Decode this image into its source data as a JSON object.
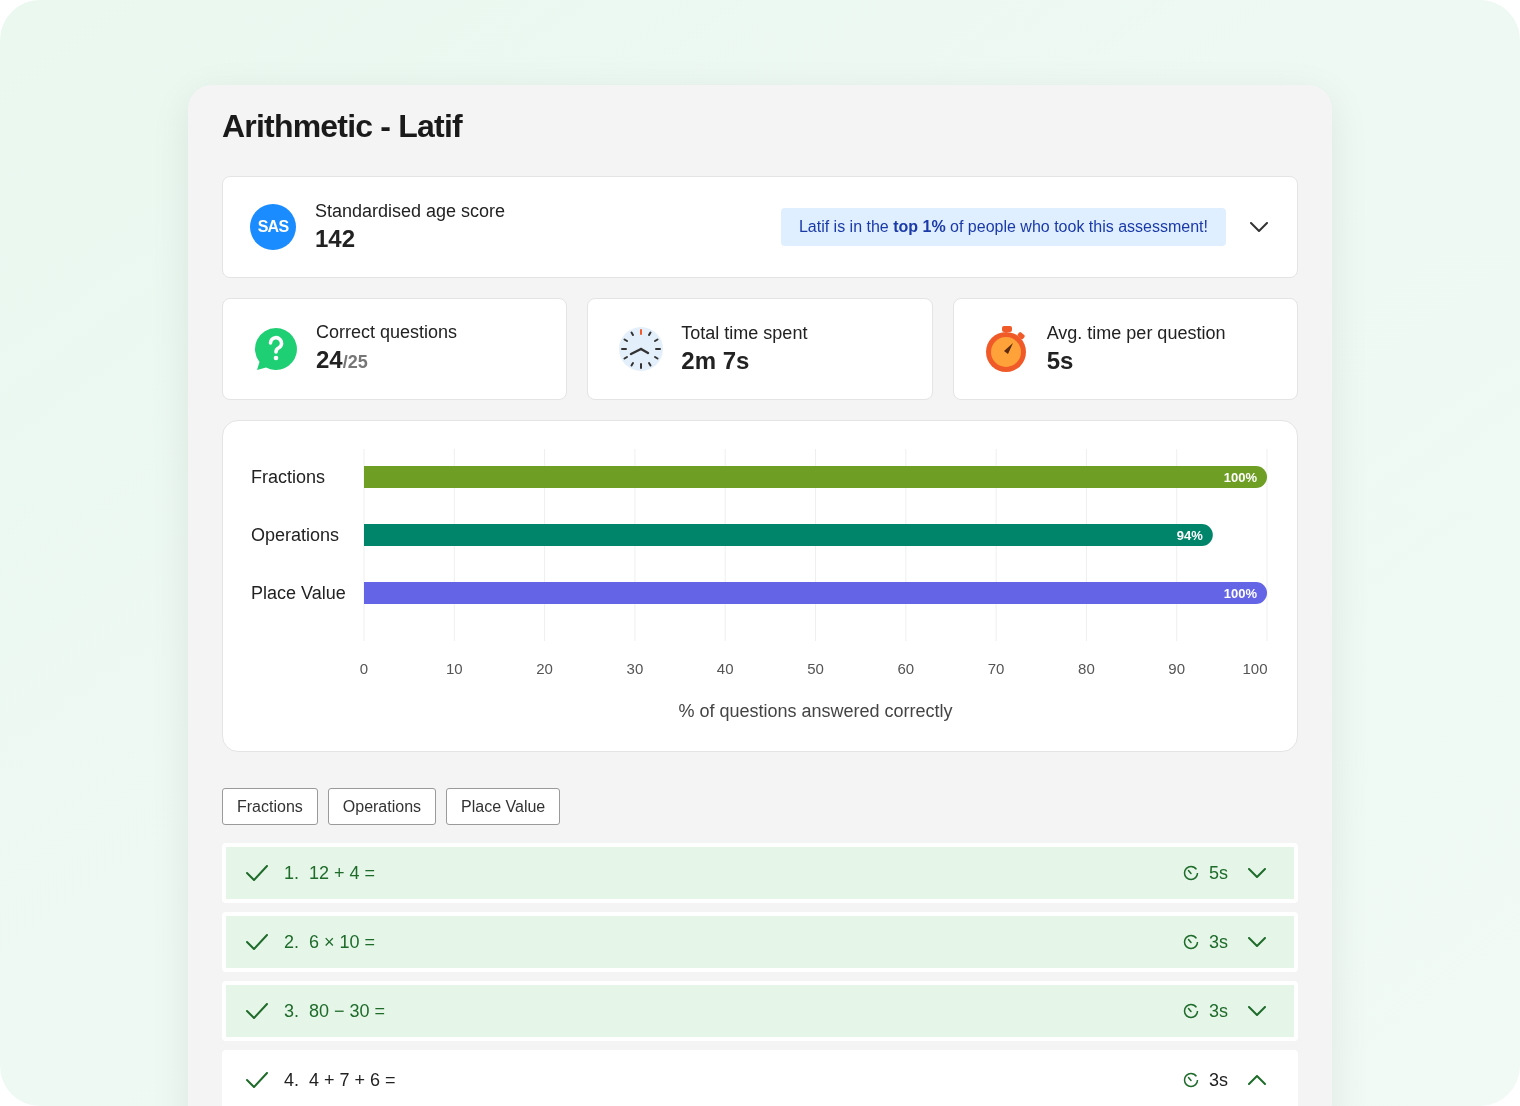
{
  "title": "Arithmetic - Latif",
  "sas": {
    "badge": "SAS",
    "label": "Standardised age score",
    "value": "142",
    "message": "Latif is in the **top 1%** of people who took this assessment!",
    "expanded": false
  },
  "stats": [
    {
      "kind": "correct",
      "label": "Correct questions",
      "value": "24",
      "suffix": "/25"
    },
    {
      "kind": "clock",
      "label": "Total time spent",
      "value": "2m 7s"
    },
    {
      "kind": "stopwatch",
      "label": "Avg. time per question",
      "value": "5s"
    }
  ],
  "chart_data": {
    "type": "bar",
    "orientation": "horizontal",
    "xlabel": "% of questions answered correctly",
    "categories": [
      "Fractions",
      "Operations",
      "Place Value"
    ],
    "series": [
      {
        "values": [
          100,
          94,
          100
        ]
      }
    ],
    "value_labels": [
      "100%",
      "94%",
      "100%"
    ],
    "grid": true,
    "colors": [
      "#6f9e25",
      "#00856a",
      "#6464e6"
    ],
    "xlim": [
      0,
      100
    ],
    "xticks": [
      0,
      10,
      20,
      30,
      40,
      50,
      60,
      70,
      80,
      90,
      100
    ]
  },
  "filters": [
    {
      "label": "Fractions",
      "selected": false
    },
    {
      "label": "Operations",
      "selected": false
    },
    {
      "label": "Place Value",
      "selected": false
    }
  ],
  "questions": [
    {
      "number": "1.",
      "text": "12 + 4 =",
      "time": "5s",
      "correct": true,
      "expanded": false
    },
    {
      "number": "2.",
      "text": "6 × 10 =",
      "time": "3s",
      "correct": true,
      "expanded": false
    },
    {
      "number": "3.",
      "text": "80 − 30 =",
      "time": "3s",
      "correct": true,
      "expanded": false
    },
    {
      "number": "4.",
      "text": "4 + 7 + 6 =",
      "time": "3s",
      "correct": true,
      "expanded": true
    }
  ]
}
